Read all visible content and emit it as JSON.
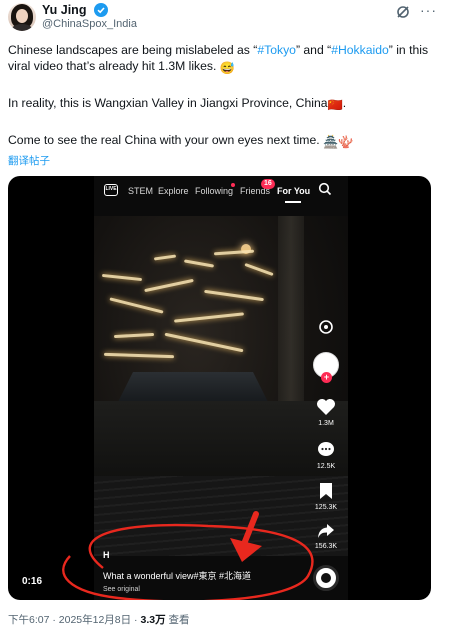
{
  "author": {
    "name": "Yu Jing",
    "handle": "@ChinaSpox_India",
    "verified": true,
    "icons": [
      "avatar",
      "verified-badge-icon",
      "grok-icon",
      "more-icon"
    ]
  },
  "tweet": {
    "p1_before": "Chinese landscapes are being mislabeled as “",
    "hashtag1": "#Tokyo",
    "p1_mid": "” and “",
    "hashtag2": "#Hokkaido",
    "p1_after": "” in this viral video that’s already hit 1.3M likes.",
    "p1_emoji": "😅",
    "p2": "In reality, this is Wangxian Valley in Jiangxi Province, China",
    "p2_emoji": "🇨🇳",
    "p2_end": ".",
    "p3": "Come to see the real China with your own eyes next time.",
    "p3_emojis": "🏯🪸",
    "translate_label": "翻译帖子"
  },
  "video": {
    "top_tabs": [
      "STEM",
      "Explore",
      "Following",
      "Friends",
      "For You"
    ],
    "active_tab": "For You",
    "friends_badge": "16",
    "live_label": "LIVE",
    "side": {
      "likes": "1.3M",
      "comments": "12.5K",
      "saves": "125.3K",
      "shares": "156.3K"
    },
    "caption_user": "H",
    "caption_text": "What a wonderful view#東京 #北海道",
    "see_original": "See original",
    "duration": "0:16",
    "accent_color": "#fe2c55",
    "annotation_color": "#e8281e"
  },
  "footer": {
    "time_date": "下午6:07 · 2025年12月8日 · ",
    "views": "3.3万",
    "views_label": " 查看"
  }
}
